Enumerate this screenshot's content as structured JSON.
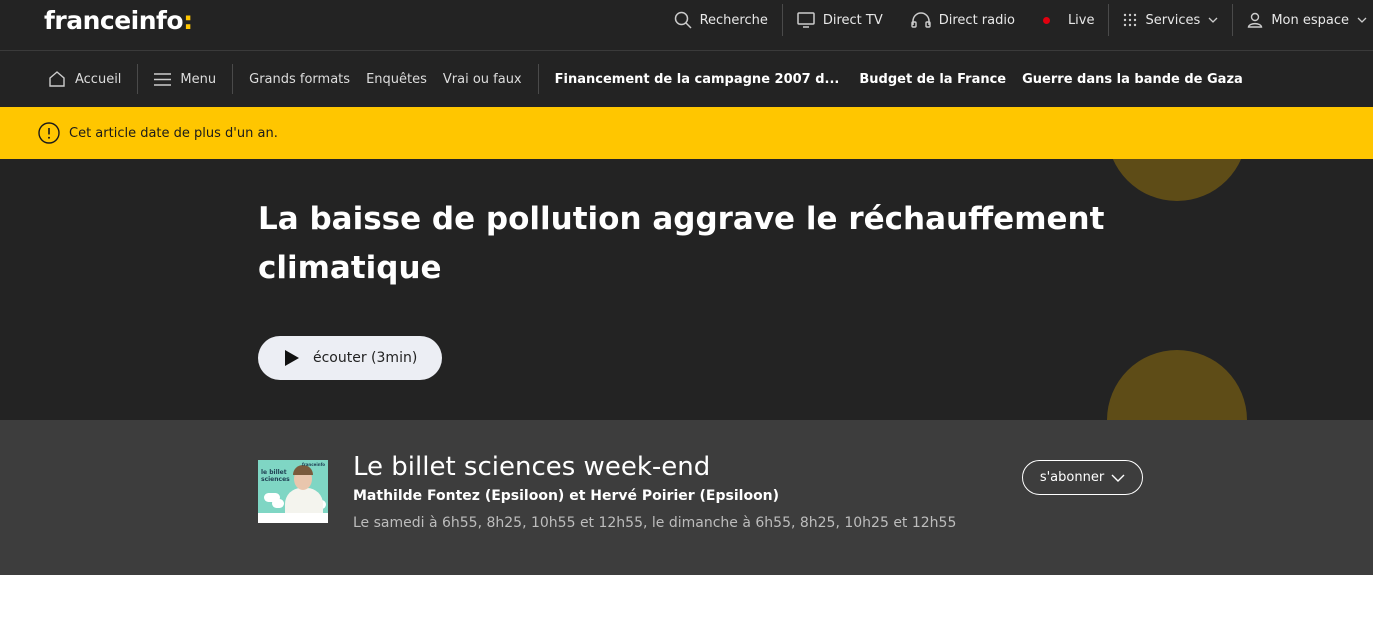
{
  "header": {
    "logo_text": "franceinfo",
    "logo_colon": ":",
    "nav": [
      {
        "label": "Recherche",
        "icon": "search-icon"
      },
      {
        "label": "Direct TV",
        "icon": "tv-icon"
      },
      {
        "label": "Direct radio",
        "icon": "headphones-icon"
      },
      {
        "label": "Live",
        "icon": "live-dot-icon"
      },
      {
        "label": "Services",
        "icon": "grid-icon"
      },
      {
        "label": "Mon espace",
        "icon": "user-icon"
      }
    ]
  },
  "subnav": {
    "home_label": "Accueil",
    "menu_label": "Menu",
    "links": [
      "Grands formats",
      "Enquêtes",
      "Vrai ou faux"
    ],
    "topics": [
      "Financement de la campagne 2007 d...",
      "Budget de la France",
      "Guerre dans la bande de Gaza"
    ]
  },
  "alert": {
    "text": "Cet article date de plus d'un an."
  },
  "article": {
    "title": "La baisse de pollution aggrave le réchauffement climatique",
    "listen_label": "écouter (3min)"
  },
  "show": {
    "title": "Le billet sciences week-end",
    "authors": "Mathilde Fontez (Epsiloon) et Hervé Poirier (Epsiloon)",
    "schedule": "Le samedi à 6h55, 8h25, 10h55 et 12h55, le dimanche à 6h55, 8h25, 10h25 et 12h55",
    "subscribe_label": "s'abonner",
    "thumb_label": "le billet sciences",
    "thumb_brand": "franceinfo"
  },
  "colors": {
    "brand_yellow": "#ffc600",
    "dark_bg": "#232323",
    "show_bg": "#3d3d3d",
    "live_red": "#e1000f"
  }
}
